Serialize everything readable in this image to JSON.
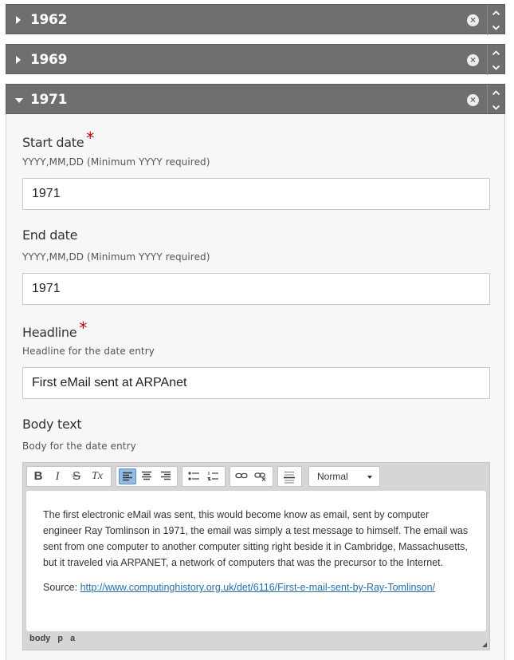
{
  "accordion": [
    {
      "year": "1962",
      "expanded": false
    },
    {
      "year": "1969",
      "expanded": false
    },
    {
      "year": "1971",
      "expanded": true
    }
  ],
  "icons": {
    "remove": "close-circle-icon",
    "move_up": "chevron-up-icon",
    "move_down": "chevron-down-icon"
  },
  "form": {
    "start_date": {
      "label": "Start date",
      "required_mark": "*",
      "description": "YYYY,MM,DD (Minimum YYYY required)",
      "value": "1971"
    },
    "end_date": {
      "label": "End date",
      "description": "YYYY,MM,DD (Minimum YYYY required)",
      "value": "1971"
    },
    "headline": {
      "label": "Headline",
      "required_mark": "*",
      "description": "Headline for the date entry",
      "value": "First eMail sent at ARPAnet"
    },
    "body": {
      "label": "Body text",
      "description": "Body for the date entry",
      "toolbar": {
        "bold": "B",
        "italic": "I",
        "strike": "S",
        "remove_format": "Tx",
        "format_select": "Normal"
      },
      "paragraph": "The first electronic eMail was sent, this would become know as email, sent by computer engineer Ray Tomlinson in 1971, the email was simply a test message to himself. The email was sent from one computer to another computer sitting right beside it in Cambridge, Massachusetts, but it traveled via ARPANET, a network of computers that was the precursor to the Internet.",
      "source_label": "Source: ",
      "source_link": "http://www.computinghistory.org.uk/det/6116/First-e-mail-sent-by-Ray-Tomlinson/",
      "element_path": [
        "body",
        "p",
        "a"
      ]
    }
  },
  "colors": {
    "header_bg": "#6f6f6f",
    "panel_bg": "#f7f7f7",
    "required": "#c00000",
    "link": "#2a6ea8",
    "active_button": "#92bce5"
  }
}
